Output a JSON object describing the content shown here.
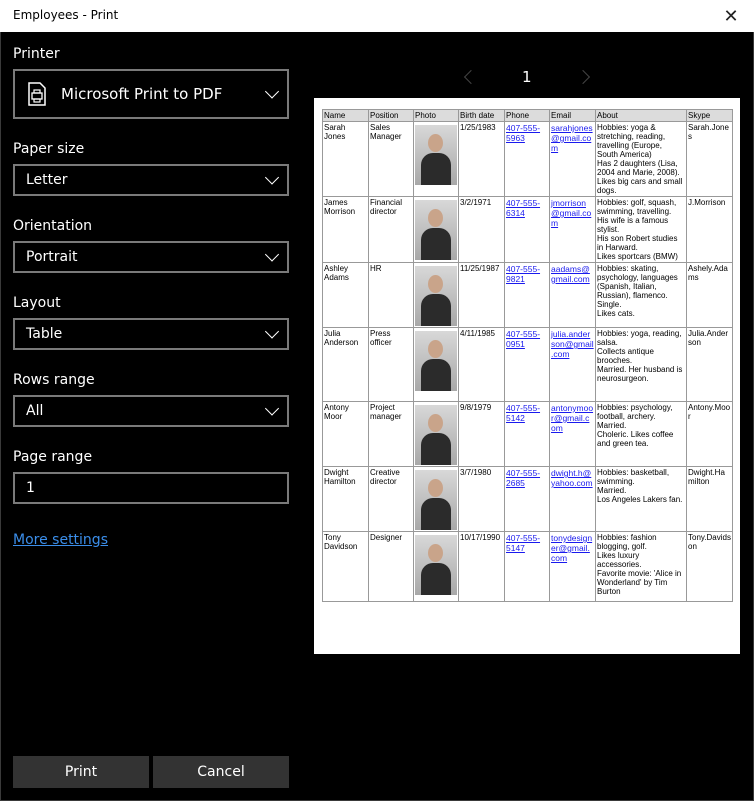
{
  "window": {
    "title": "Employees - Print",
    "close_glyph": "✕"
  },
  "settings": {
    "printer_label": "Printer",
    "printer_value": "Microsoft Print to PDF",
    "paper_size_label": "Paper size",
    "paper_size_value": "Letter",
    "orientation_label": "Orientation",
    "orientation_value": "Portrait",
    "layout_label": "Layout",
    "layout_value": "Table",
    "rows_range_label": "Rows range",
    "rows_range_value": "All",
    "page_range_label": "Page range",
    "page_range_value": "1",
    "more_settings": "More settings"
  },
  "buttons": {
    "print": "Print",
    "cancel": "Cancel"
  },
  "preview": {
    "page_number": "1",
    "columns": [
      "Name",
      "Position",
      "Photo",
      "Birth date",
      "Phone",
      "Email",
      "About",
      "Skype"
    ],
    "rows": [
      {
        "name": "Sarah Jones",
        "position": "Sales Manager",
        "birth": "1/25/1983",
        "phone": "407-555-5963",
        "email": "sarahjones@gmail.com",
        "about": "Hobbies: yoga & stretching, reading, travelling (Europe, South America)\nHas 2 daughters (Lisa, 2004 and Marie, 2008).\nLikes big cars and small dogs.",
        "skype": "Sarah.Jones"
      },
      {
        "name": "James Morrison",
        "position": "Financial director",
        "birth": "3/2/1971",
        "phone": "407-555-6314",
        "email": "jmorrison@gmail.com",
        "about": "Hobbies: golf, squash, swimming, travelling.\nHis wife is a famous stylist.\nHis son Robert studies in Harward.\nLikes sportcars  (BMW)",
        "skype": "J.Morrison"
      },
      {
        "name": "Ashley Adams",
        "position": "HR",
        "birth": "11/25/1987",
        "phone": "407-555-9821",
        "email": "aadams@gmail.com",
        "about": "Hobbies: skating, psychology, languages (Spanish,  Italian, Russian), flamenco.\nSingle.\nLikes cats.",
        "skype": "Ashely.Adams"
      },
      {
        "name": "Julia Anderson",
        "position": "Press officer",
        "birth": "4/11/1985",
        "phone": "407-555-0951",
        "email": "julia.anderson@gmail.com",
        "about": "Hobbies: yoga, reading,  salsa.\nCollects antique brooches.\nMarried. Her husband is neurosurgeon.",
        "skype": "Julia.Anderson"
      },
      {
        "name": "Antony Moor",
        "position": "Project manager",
        "birth": "9/8/1979",
        "phone": "407-555-5142",
        "email": "antonymoor@gmail.com",
        "about": "Hobbies: psychology, football, archery.\nMarried.\nCholeric. Likes coffee and green tea.",
        "skype": "Antony.Moor"
      },
      {
        "name": "Dwight Hamilton",
        "position": "Creative director",
        "birth": "3/7/1980",
        "phone": "407-555-2685",
        "email": "dwight.h@yahoo.com",
        "about": "Hobbies: basketball, swimming.\nMarried.\nLos Angeles Lakers fan.",
        "skype": "Dwight.Hamilton"
      },
      {
        "name": "Tony Davidson",
        "position": "Designer",
        "birth": "10/17/1990",
        "phone": "407-555-5147",
        "email": "tonydesigner@gmail.com",
        "about": "Hobbies: fashion blogging, golf.\nLikes luxury accessories.\nFavorite movie: 'Alice in Wonderland' by Tim Burton",
        "skype": "Tony.Davidson"
      }
    ]
  }
}
